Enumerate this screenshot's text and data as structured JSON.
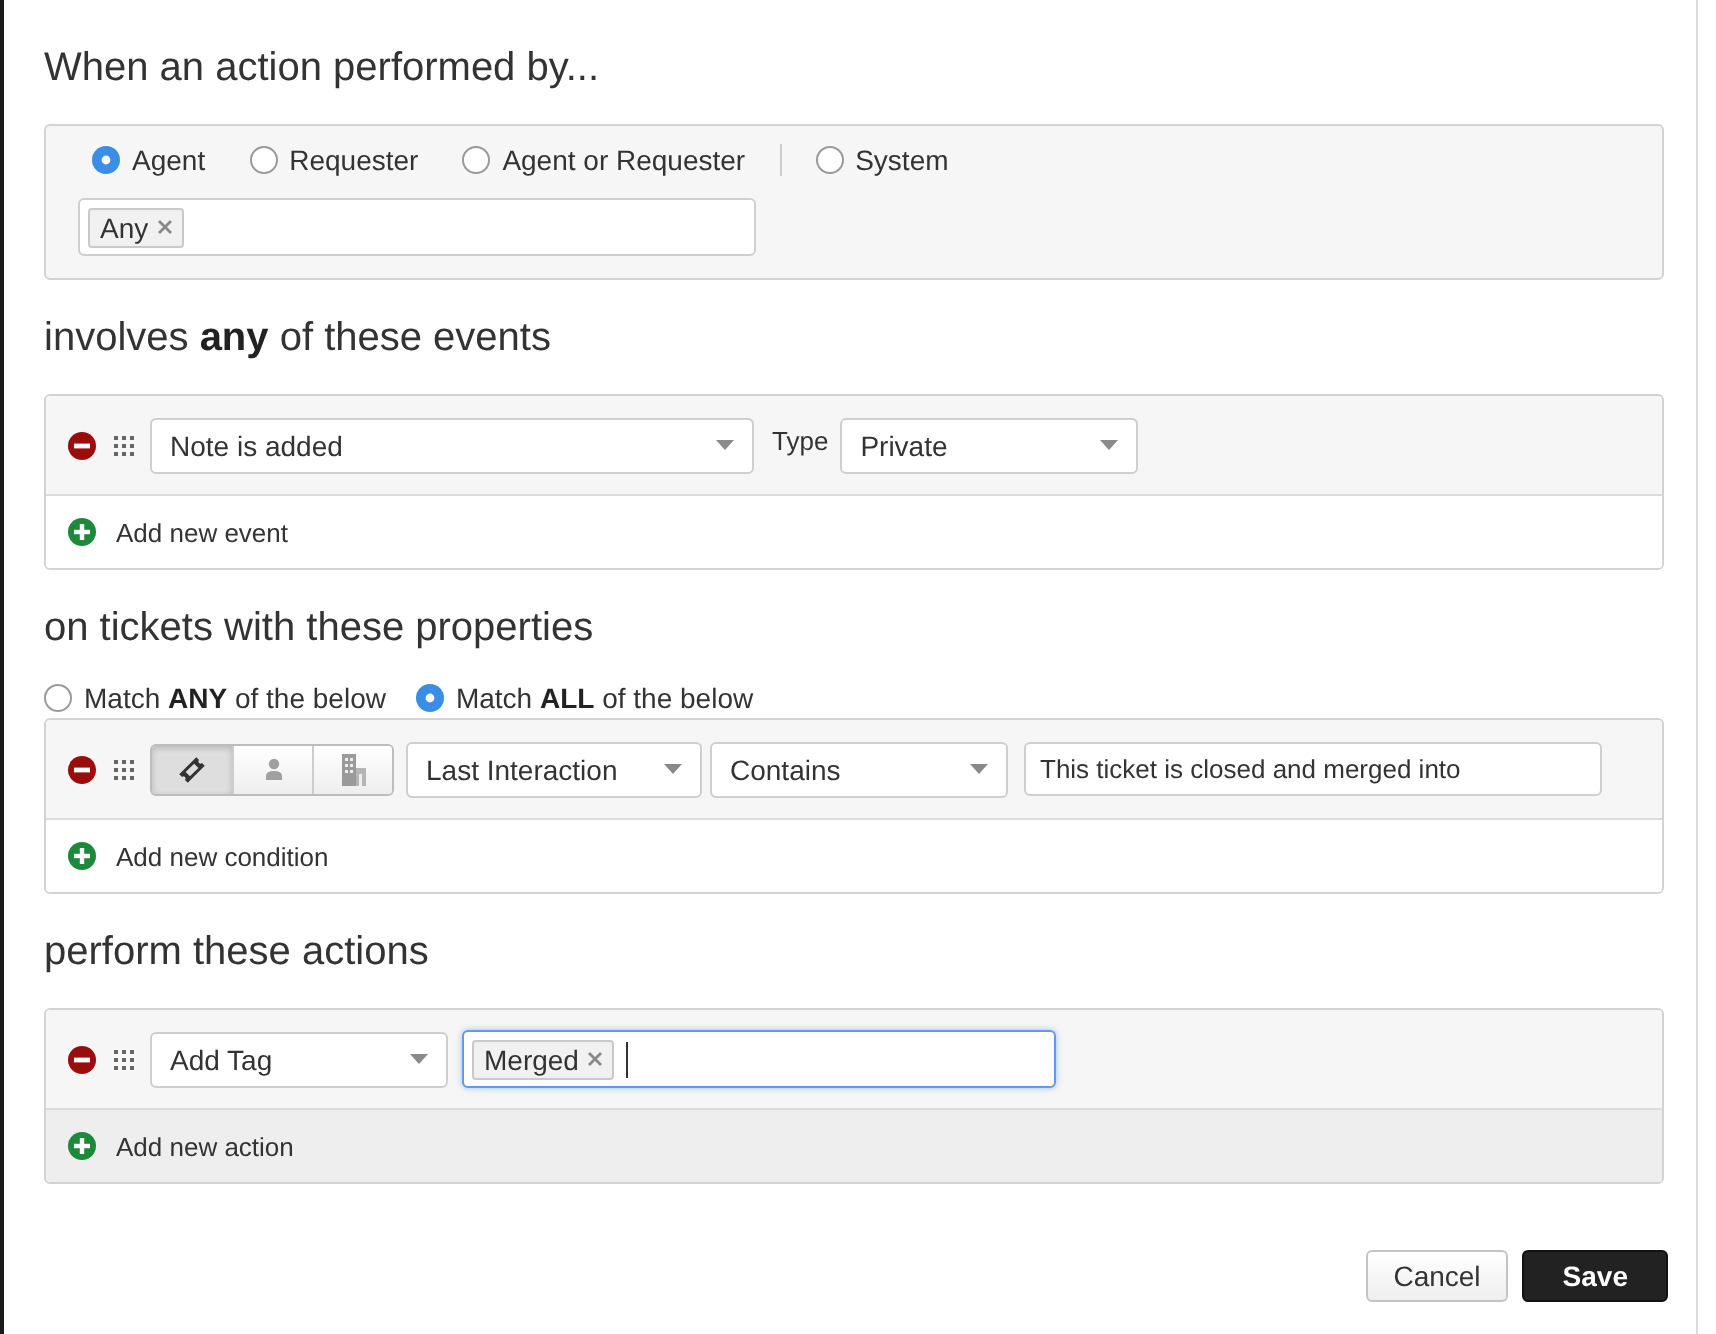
{
  "performer": {
    "heading": "When an action performed by...",
    "option_groups": [
      [
        {
          "label": "Agent",
          "selected": true
        },
        {
          "label": "Requester",
          "selected": false
        },
        {
          "label": "Agent or Requester",
          "selected": false
        }
      ],
      [
        {
          "label": "System",
          "selected": false
        }
      ]
    ],
    "tags": [
      "Any"
    ]
  },
  "events": {
    "heading": "involves **any** of these events",
    "rows": [
      {
        "event": "Note is added",
        "type_label": "Type",
        "type": "Private"
      }
    ],
    "add_label": "Add new event",
    "add_highlighted": false
  },
  "conditions": {
    "heading": "on tickets with these properties",
    "match_options": [
      {
        "label": "Match **ANY** of the below",
        "selected": false
      },
      {
        "label": "Match **ALL** of the below",
        "selected": true
      }
    ],
    "rows": [
      {
        "scopes": [
          {
            "kind": "ticket",
            "selected": true
          },
          {
            "kind": "contact",
            "selected": false
          },
          {
            "kind": "company",
            "selected": false
          }
        ],
        "field": "Last Interaction",
        "operator": "Contains",
        "value": "This ticket is closed and merged into"
      }
    ],
    "add_label": "Add new condition",
    "add_highlighted": false
  },
  "actions": {
    "heading": "perform these actions",
    "rows": [
      {
        "action": "Add Tag",
        "tags": [
          "Merged"
        ],
        "focused": true
      }
    ],
    "add_label": "Add new action",
    "add_highlighted": true
  },
  "buttons": [
    {
      "label": "Cancel",
      "kind": "secondary"
    },
    {
      "label": "Save",
      "kind": "primary"
    }
  ]
}
